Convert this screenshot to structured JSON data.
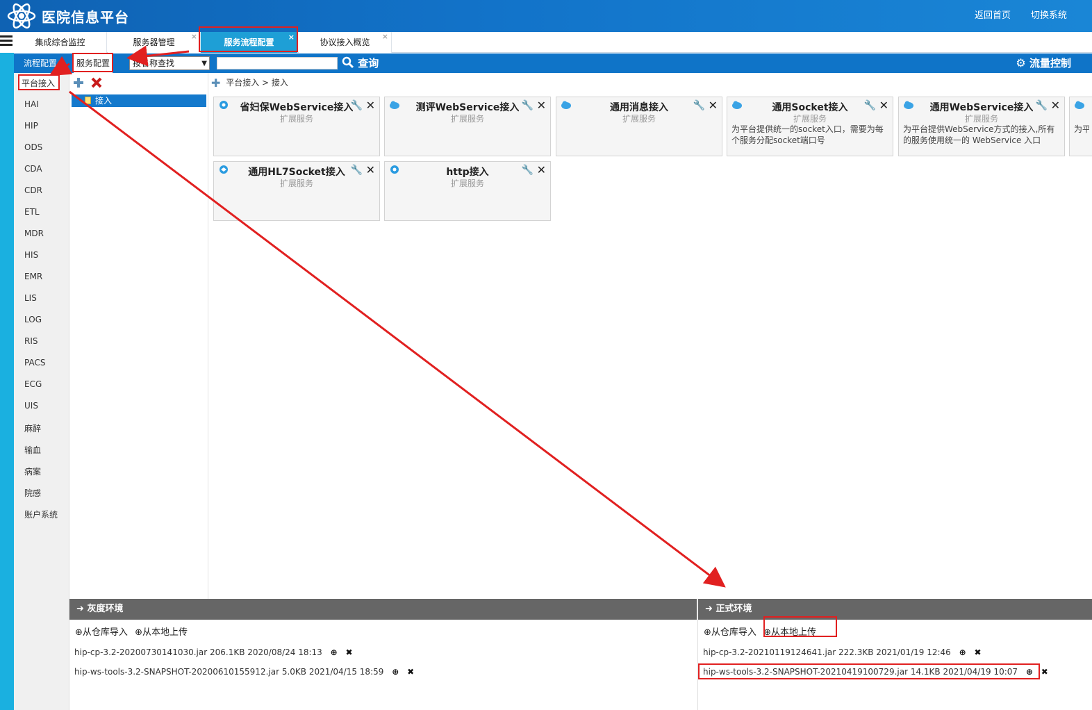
{
  "header": {
    "title": "医院信息平台",
    "links": [
      "返回首页",
      "切换系统"
    ]
  },
  "tabs": [
    {
      "label": "集成综合监控",
      "closable": false
    },
    {
      "label": "服务器管理",
      "closable": true
    },
    {
      "label": "服务流程配置",
      "closable": true,
      "active": true
    },
    {
      "label": "协议接入概览",
      "closable": true
    }
  ],
  "toolbar": {
    "tabs": [
      "流程配置",
      "服务配置"
    ],
    "search_select_value": "按名称查找",
    "search_placeholder": "",
    "query_label": "查询",
    "flow_control_label": "流量控制"
  },
  "sidebar": {
    "items": [
      "平台接入",
      "HAI",
      "HIP",
      "ODS",
      "CDA",
      "CDR",
      "ETL",
      "MDR",
      "HIS",
      "EMR",
      "LIS",
      "LOG",
      "RIS",
      "PACS",
      "ECG",
      "UIS",
      "麻醉",
      "输血",
      "病案",
      "院感",
      "账户系统"
    ]
  },
  "tree": {
    "node_label": "接入"
  },
  "breadcrumb": "平台接入 > 接入",
  "cards": [
    {
      "title": "省妇保WebService接入",
      "subtitle": "扩展服务",
      "desc": "",
      "icon": "ws-gear-icon"
    },
    {
      "title": "测评WebService接入",
      "subtitle": "扩展服务",
      "desc": "",
      "icon": "ws-cloud-icon"
    },
    {
      "title": "通用消息接入",
      "subtitle": "扩展服务",
      "desc": "",
      "icon": "msg-cloud-icon"
    },
    {
      "title": "通用Socket接入",
      "subtitle": "扩展服务",
      "desc": "为平台提供统一的socket入口，需要为每个服务分配socket端口号",
      "icon": "socket-cloud-icon"
    },
    {
      "title": "通用WebService接入",
      "subtitle": "扩展服务",
      "desc": "为平台提供WebService方式的接入,所有的服务使用统一的 WebService 入口",
      "icon": "ws-cloud-icon"
    },
    {
      "title": "",
      "subtitle": "",
      "desc": "为平",
      "icon": "rpc-cloud-icon"
    },
    {
      "title": "通用HL7Socket接入",
      "subtitle": "扩展服务",
      "desc": "",
      "icon": "hl7-icon"
    },
    {
      "title": "http接入",
      "subtitle": "扩展服务",
      "desc": "",
      "icon": "http-gear-icon"
    }
  ],
  "gray_env": {
    "title": "灰度环境",
    "import_label": "从仓库导入",
    "upload_label": "从本地上传",
    "files": [
      "hip-cp-3.2-20200730141030.jar 206.1KB 2020/08/24 18:13",
      "hip-ws-tools-3.2-SNAPSHOT-20200610155912.jar 5.0KB 2021/04/15 18:59"
    ]
  },
  "prod_env": {
    "title": "正式环境",
    "import_label": "从仓库导入",
    "upload_label": "从本地上传",
    "files": [
      "hip-cp-3.2-20210119124641.jar 222.3KB 2021/01/19 12:46",
      "hip-ws-tools-3.2-SNAPSHOT-20210419100729.jar 14.1KB 2021/04/19 10:07"
    ]
  },
  "colors": {
    "header": "#1273c9",
    "toolbar": "#0f74c8",
    "active_tab": "#1e9fd6",
    "annotation": "#e12020"
  }
}
